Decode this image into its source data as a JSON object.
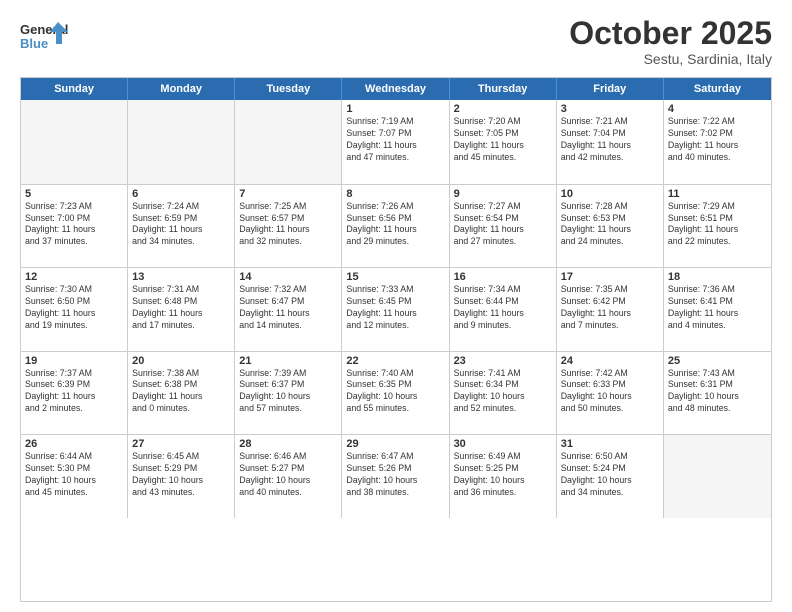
{
  "header": {
    "logo_general": "General",
    "logo_blue": "Blue",
    "month": "October 2025",
    "location": "Sestu, Sardinia, Italy"
  },
  "weekdays": [
    "Sunday",
    "Monday",
    "Tuesday",
    "Wednesday",
    "Thursday",
    "Friday",
    "Saturday"
  ],
  "weeks": [
    [
      {
        "day": "",
        "text": "",
        "empty": true
      },
      {
        "day": "",
        "text": "",
        "empty": true
      },
      {
        "day": "",
        "text": "",
        "empty": true
      },
      {
        "day": "1",
        "text": "Sunrise: 7:19 AM\nSunset: 7:07 PM\nDaylight: 11 hours\nand 47 minutes."
      },
      {
        "day": "2",
        "text": "Sunrise: 7:20 AM\nSunset: 7:05 PM\nDaylight: 11 hours\nand 45 minutes."
      },
      {
        "day": "3",
        "text": "Sunrise: 7:21 AM\nSunset: 7:04 PM\nDaylight: 11 hours\nand 42 minutes."
      },
      {
        "day": "4",
        "text": "Sunrise: 7:22 AM\nSunset: 7:02 PM\nDaylight: 11 hours\nand 40 minutes."
      }
    ],
    [
      {
        "day": "5",
        "text": "Sunrise: 7:23 AM\nSunset: 7:00 PM\nDaylight: 11 hours\nand 37 minutes."
      },
      {
        "day": "6",
        "text": "Sunrise: 7:24 AM\nSunset: 6:59 PM\nDaylight: 11 hours\nand 34 minutes."
      },
      {
        "day": "7",
        "text": "Sunrise: 7:25 AM\nSunset: 6:57 PM\nDaylight: 11 hours\nand 32 minutes."
      },
      {
        "day": "8",
        "text": "Sunrise: 7:26 AM\nSunset: 6:56 PM\nDaylight: 11 hours\nand 29 minutes."
      },
      {
        "day": "9",
        "text": "Sunrise: 7:27 AM\nSunset: 6:54 PM\nDaylight: 11 hours\nand 27 minutes."
      },
      {
        "day": "10",
        "text": "Sunrise: 7:28 AM\nSunset: 6:53 PM\nDaylight: 11 hours\nand 24 minutes."
      },
      {
        "day": "11",
        "text": "Sunrise: 7:29 AM\nSunset: 6:51 PM\nDaylight: 11 hours\nand 22 minutes."
      }
    ],
    [
      {
        "day": "12",
        "text": "Sunrise: 7:30 AM\nSunset: 6:50 PM\nDaylight: 11 hours\nand 19 minutes."
      },
      {
        "day": "13",
        "text": "Sunrise: 7:31 AM\nSunset: 6:48 PM\nDaylight: 11 hours\nand 17 minutes."
      },
      {
        "day": "14",
        "text": "Sunrise: 7:32 AM\nSunset: 6:47 PM\nDaylight: 11 hours\nand 14 minutes."
      },
      {
        "day": "15",
        "text": "Sunrise: 7:33 AM\nSunset: 6:45 PM\nDaylight: 11 hours\nand 12 minutes."
      },
      {
        "day": "16",
        "text": "Sunrise: 7:34 AM\nSunset: 6:44 PM\nDaylight: 11 hours\nand 9 minutes."
      },
      {
        "day": "17",
        "text": "Sunrise: 7:35 AM\nSunset: 6:42 PM\nDaylight: 11 hours\nand 7 minutes."
      },
      {
        "day": "18",
        "text": "Sunrise: 7:36 AM\nSunset: 6:41 PM\nDaylight: 11 hours\nand 4 minutes."
      }
    ],
    [
      {
        "day": "19",
        "text": "Sunrise: 7:37 AM\nSunset: 6:39 PM\nDaylight: 11 hours\nand 2 minutes."
      },
      {
        "day": "20",
        "text": "Sunrise: 7:38 AM\nSunset: 6:38 PM\nDaylight: 11 hours\nand 0 minutes."
      },
      {
        "day": "21",
        "text": "Sunrise: 7:39 AM\nSunset: 6:37 PM\nDaylight: 10 hours\nand 57 minutes."
      },
      {
        "day": "22",
        "text": "Sunrise: 7:40 AM\nSunset: 6:35 PM\nDaylight: 10 hours\nand 55 minutes."
      },
      {
        "day": "23",
        "text": "Sunrise: 7:41 AM\nSunset: 6:34 PM\nDaylight: 10 hours\nand 52 minutes."
      },
      {
        "day": "24",
        "text": "Sunrise: 7:42 AM\nSunset: 6:33 PM\nDaylight: 10 hours\nand 50 minutes."
      },
      {
        "day": "25",
        "text": "Sunrise: 7:43 AM\nSunset: 6:31 PM\nDaylight: 10 hours\nand 48 minutes."
      }
    ],
    [
      {
        "day": "26",
        "text": "Sunrise: 6:44 AM\nSunset: 5:30 PM\nDaylight: 10 hours\nand 45 minutes."
      },
      {
        "day": "27",
        "text": "Sunrise: 6:45 AM\nSunset: 5:29 PM\nDaylight: 10 hours\nand 43 minutes."
      },
      {
        "day": "28",
        "text": "Sunrise: 6:46 AM\nSunset: 5:27 PM\nDaylight: 10 hours\nand 40 minutes."
      },
      {
        "day": "29",
        "text": "Sunrise: 6:47 AM\nSunset: 5:26 PM\nDaylight: 10 hours\nand 38 minutes."
      },
      {
        "day": "30",
        "text": "Sunrise: 6:49 AM\nSunset: 5:25 PM\nDaylight: 10 hours\nand 36 minutes."
      },
      {
        "day": "31",
        "text": "Sunrise: 6:50 AM\nSunset: 5:24 PM\nDaylight: 10 hours\nand 34 minutes."
      },
      {
        "day": "",
        "text": "",
        "empty": true
      }
    ]
  ]
}
